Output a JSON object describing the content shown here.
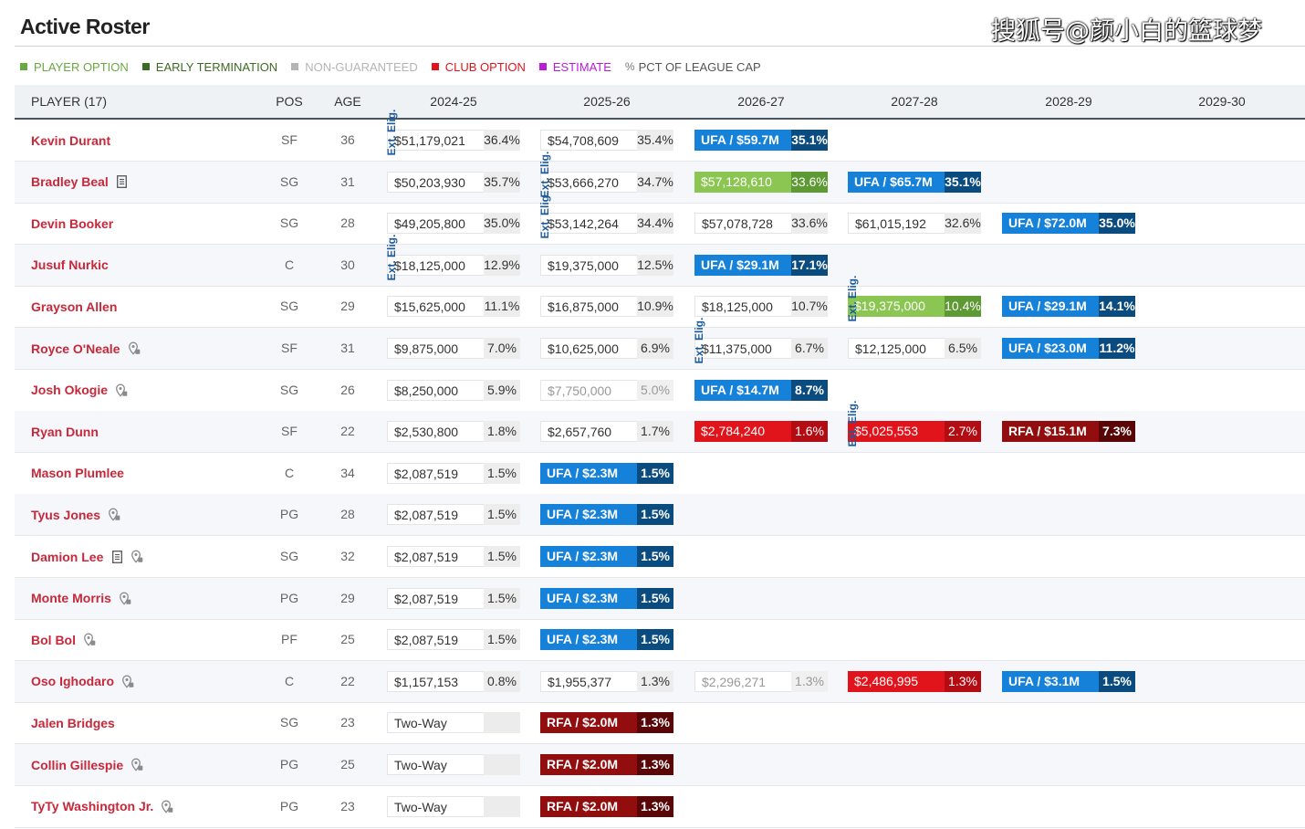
{
  "header": {
    "title": "Active Roster",
    "watermark": "搜狐号@颜小白的篮球梦"
  },
  "legend": [
    {
      "label": "PLAYER OPTION",
      "color": "#6aa843"
    },
    {
      "label": "EARLY TERMINATION",
      "color": "#3d6b23"
    },
    {
      "label": "NON-GUARANTEED",
      "color": "#b5b5b5"
    },
    {
      "label": "CLUB OPTION",
      "color": "#e1141c"
    },
    {
      "label": "ESTIMATE",
      "color": "#b91ed6"
    },
    {
      "label": "PCT OF LEAGUE CAP",
      "color": "#777777",
      "symbol": "%"
    }
  ],
  "table": {
    "columns": {
      "player": "PLAYER (17)",
      "pos": "POS",
      "age": "AGE",
      "seasons": [
        "2024-25",
        "2025-26",
        "2026-27",
        "2027-28",
        "2028-29",
        "2029-30"
      ]
    },
    "ext_label": "Ext. Elig.",
    "rows": [
      {
        "name": "Kevin Durant",
        "icons": [],
        "pos": "SF",
        "age": "36",
        "contracts": [
          {
            "amount": "$51,179,021",
            "pct": "36.4%",
            "style": "plain",
            "ext": true
          },
          {
            "amount": "$54,708,609",
            "pct": "35.4%",
            "style": "plain"
          },
          {
            "amount": "UFA / $59.7M",
            "pct": "35.1%",
            "style": "ufa"
          }
        ]
      },
      {
        "name": "Bradley Beal",
        "icons": [
          "document-icon"
        ],
        "pos": "SG",
        "age": "31",
        "contracts": [
          {
            "amount": "$50,203,930",
            "pct": "35.7%",
            "style": "plain"
          },
          {
            "amount": "$53,666,270",
            "pct": "34.7%",
            "style": "plain",
            "ext": true
          },
          {
            "amount": "$57,128,610",
            "pct": "33.6%",
            "style": "player"
          },
          {
            "amount": "UFA / $65.7M",
            "pct": "35.1%",
            "style": "ufa"
          }
        ]
      },
      {
        "name": "Devin Booker",
        "icons": [],
        "pos": "SG",
        "age": "28",
        "contracts": [
          {
            "amount": "$49,205,800",
            "pct": "35.0%",
            "style": "plain"
          },
          {
            "amount": "$53,142,264",
            "pct": "34.4%",
            "style": "plain",
            "ext": true
          },
          {
            "amount": "$57,078,728",
            "pct": "33.6%",
            "style": "plain"
          },
          {
            "amount": "$61,015,192",
            "pct": "32.6%",
            "style": "plain"
          },
          {
            "amount": "UFA / $72.0M",
            "pct": "35.0%",
            "style": "ufa"
          }
        ]
      },
      {
        "name": "Jusuf Nurkic",
        "icons": [],
        "pos": "C",
        "age": "30",
        "contracts": [
          {
            "amount": "$18,125,000",
            "pct": "12.9%",
            "style": "plain",
            "ext": true
          },
          {
            "amount": "$19,375,000",
            "pct": "12.5%",
            "style": "plain"
          },
          {
            "amount": "UFA / $29.1M",
            "pct": "17.1%",
            "style": "ufa"
          }
        ]
      },
      {
        "name": "Grayson Allen",
        "icons": [],
        "pos": "SG",
        "age": "29",
        "contracts": [
          {
            "amount": "$15,625,000",
            "pct": "11.1%",
            "style": "plain"
          },
          {
            "amount": "$16,875,000",
            "pct": "10.9%",
            "style": "plain"
          },
          {
            "amount": "$18,125,000",
            "pct": "10.7%",
            "style": "plain"
          },
          {
            "amount": "$19,375,000",
            "pct": "10.4%",
            "style": "player",
            "ext": true
          },
          {
            "amount": "UFA / $29.1M",
            "pct": "14.1%",
            "style": "ufa"
          }
        ]
      },
      {
        "name": "Royce O'Neale",
        "icons": [
          "bird-rights-icon"
        ],
        "pos": "SF",
        "age": "31",
        "contracts": [
          {
            "amount": "$9,875,000",
            "pct": "7.0%",
            "style": "plain"
          },
          {
            "amount": "$10,625,000",
            "pct": "6.9%",
            "style": "plain"
          },
          {
            "amount": "$11,375,000",
            "pct": "6.7%",
            "style": "plain",
            "ext": true
          },
          {
            "amount": "$12,125,000",
            "pct": "6.5%",
            "style": "plain"
          },
          {
            "amount": "UFA / $23.0M",
            "pct": "11.2%",
            "style": "ufa"
          }
        ]
      },
      {
        "name": "Josh Okogie",
        "icons": [
          "bird-rights-icon"
        ],
        "pos": "SG",
        "age": "26",
        "contracts": [
          {
            "amount": "$8,250,000",
            "pct": "5.9%",
            "style": "plain"
          },
          {
            "amount": "$7,750,000",
            "pct": "5.0%",
            "style": "faded"
          },
          {
            "amount": "UFA / $14.7M",
            "pct": "8.7%",
            "style": "ufa"
          }
        ]
      },
      {
        "name": "Ryan Dunn",
        "icons": [],
        "pos": "SF",
        "age": "22",
        "contracts": [
          {
            "amount": "$2,530,800",
            "pct": "1.8%",
            "style": "plain"
          },
          {
            "amount": "$2,657,760",
            "pct": "1.7%",
            "style": "plain"
          },
          {
            "amount": "$2,784,240",
            "pct": "1.6%",
            "style": "club"
          },
          {
            "amount": "$5,025,553",
            "pct": "2.7%",
            "style": "club",
            "ext": true
          },
          {
            "amount": "RFA / $15.1M",
            "pct": "7.3%",
            "style": "rfa"
          }
        ]
      },
      {
        "name": "Mason Plumlee",
        "icons": [],
        "pos": "C",
        "age": "34",
        "contracts": [
          {
            "amount": "$2,087,519",
            "pct": "1.5%",
            "style": "plain"
          },
          {
            "amount": "UFA / $2.3M",
            "pct": "1.5%",
            "style": "ufa"
          }
        ]
      },
      {
        "name": "Tyus Jones",
        "icons": [
          "bird-rights-icon"
        ],
        "pos": "PG",
        "age": "28",
        "contracts": [
          {
            "amount": "$2,087,519",
            "pct": "1.5%",
            "style": "plain"
          },
          {
            "amount": "UFA / $2.3M",
            "pct": "1.5%",
            "style": "ufa"
          }
        ]
      },
      {
        "name": "Damion Lee",
        "icons": [
          "document-icon",
          "bird-rights-icon"
        ],
        "pos": "SG",
        "age": "32",
        "contracts": [
          {
            "amount": "$2,087,519",
            "pct": "1.5%",
            "style": "plain"
          },
          {
            "amount": "UFA / $2.3M",
            "pct": "1.5%",
            "style": "ufa"
          }
        ]
      },
      {
        "name": "Monte Morris",
        "icons": [
          "bird-rights-icon"
        ],
        "pos": "PG",
        "age": "29",
        "contracts": [
          {
            "amount": "$2,087,519",
            "pct": "1.5%",
            "style": "plain"
          },
          {
            "amount": "UFA / $2.3M",
            "pct": "1.5%",
            "style": "ufa"
          }
        ]
      },
      {
        "name": "Bol Bol",
        "icons": [
          "bird-rights-icon"
        ],
        "pos": "PF",
        "age": "25",
        "contracts": [
          {
            "amount": "$2,087,519",
            "pct": "1.5%",
            "style": "plain"
          },
          {
            "amount": "UFA / $2.3M",
            "pct": "1.5%",
            "style": "ufa"
          }
        ]
      },
      {
        "name": "Oso Ighodaro",
        "icons": [
          "bird-rights-icon"
        ],
        "pos": "C",
        "age": "22",
        "contracts": [
          {
            "amount": "$1,157,153",
            "pct": "0.8%",
            "style": "plain"
          },
          {
            "amount": "$1,955,377",
            "pct": "1.3%",
            "style": "plain"
          },
          {
            "amount": "$2,296,271",
            "pct": "1.3%",
            "style": "faded"
          },
          {
            "amount": "$2,486,995",
            "pct": "1.3%",
            "style": "club"
          },
          {
            "amount": "UFA / $3.1M",
            "pct": "1.5%",
            "style": "ufa"
          }
        ]
      },
      {
        "name": "Jalen Bridges",
        "icons": [],
        "pos": "SG",
        "age": "23",
        "contracts": [
          {
            "amount": "Two-Way",
            "pct": "",
            "style": "twoway"
          },
          {
            "amount": "RFA / $2.0M",
            "pct": "1.3%",
            "style": "rfa"
          }
        ]
      },
      {
        "name": "Collin Gillespie",
        "icons": [
          "bird-rights-icon"
        ],
        "pos": "PG",
        "age": "25",
        "contracts": [
          {
            "amount": "Two-Way",
            "pct": "",
            "style": "twoway"
          },
          {
            "amount": "RFA / $2.0M",
            "pct": "1.3%",
            "style": "rfa"
          }
        ]
      },
      {
        "name": "TyTy Washington Jr.",
        "icons": [
          "bird-rights-icon"
        ],
        "pos": "PG",
        "age": "23",
        "contracts": [
          {
            "amount": "Two-Way",
            "pct": "",
            "style": "twoway"
          },
          {
            "amount": "RFA / $2.0M",
            "pct": "1.3%",
            "style": "rfa"
          }
        ]
      }
    ]
  }
}
